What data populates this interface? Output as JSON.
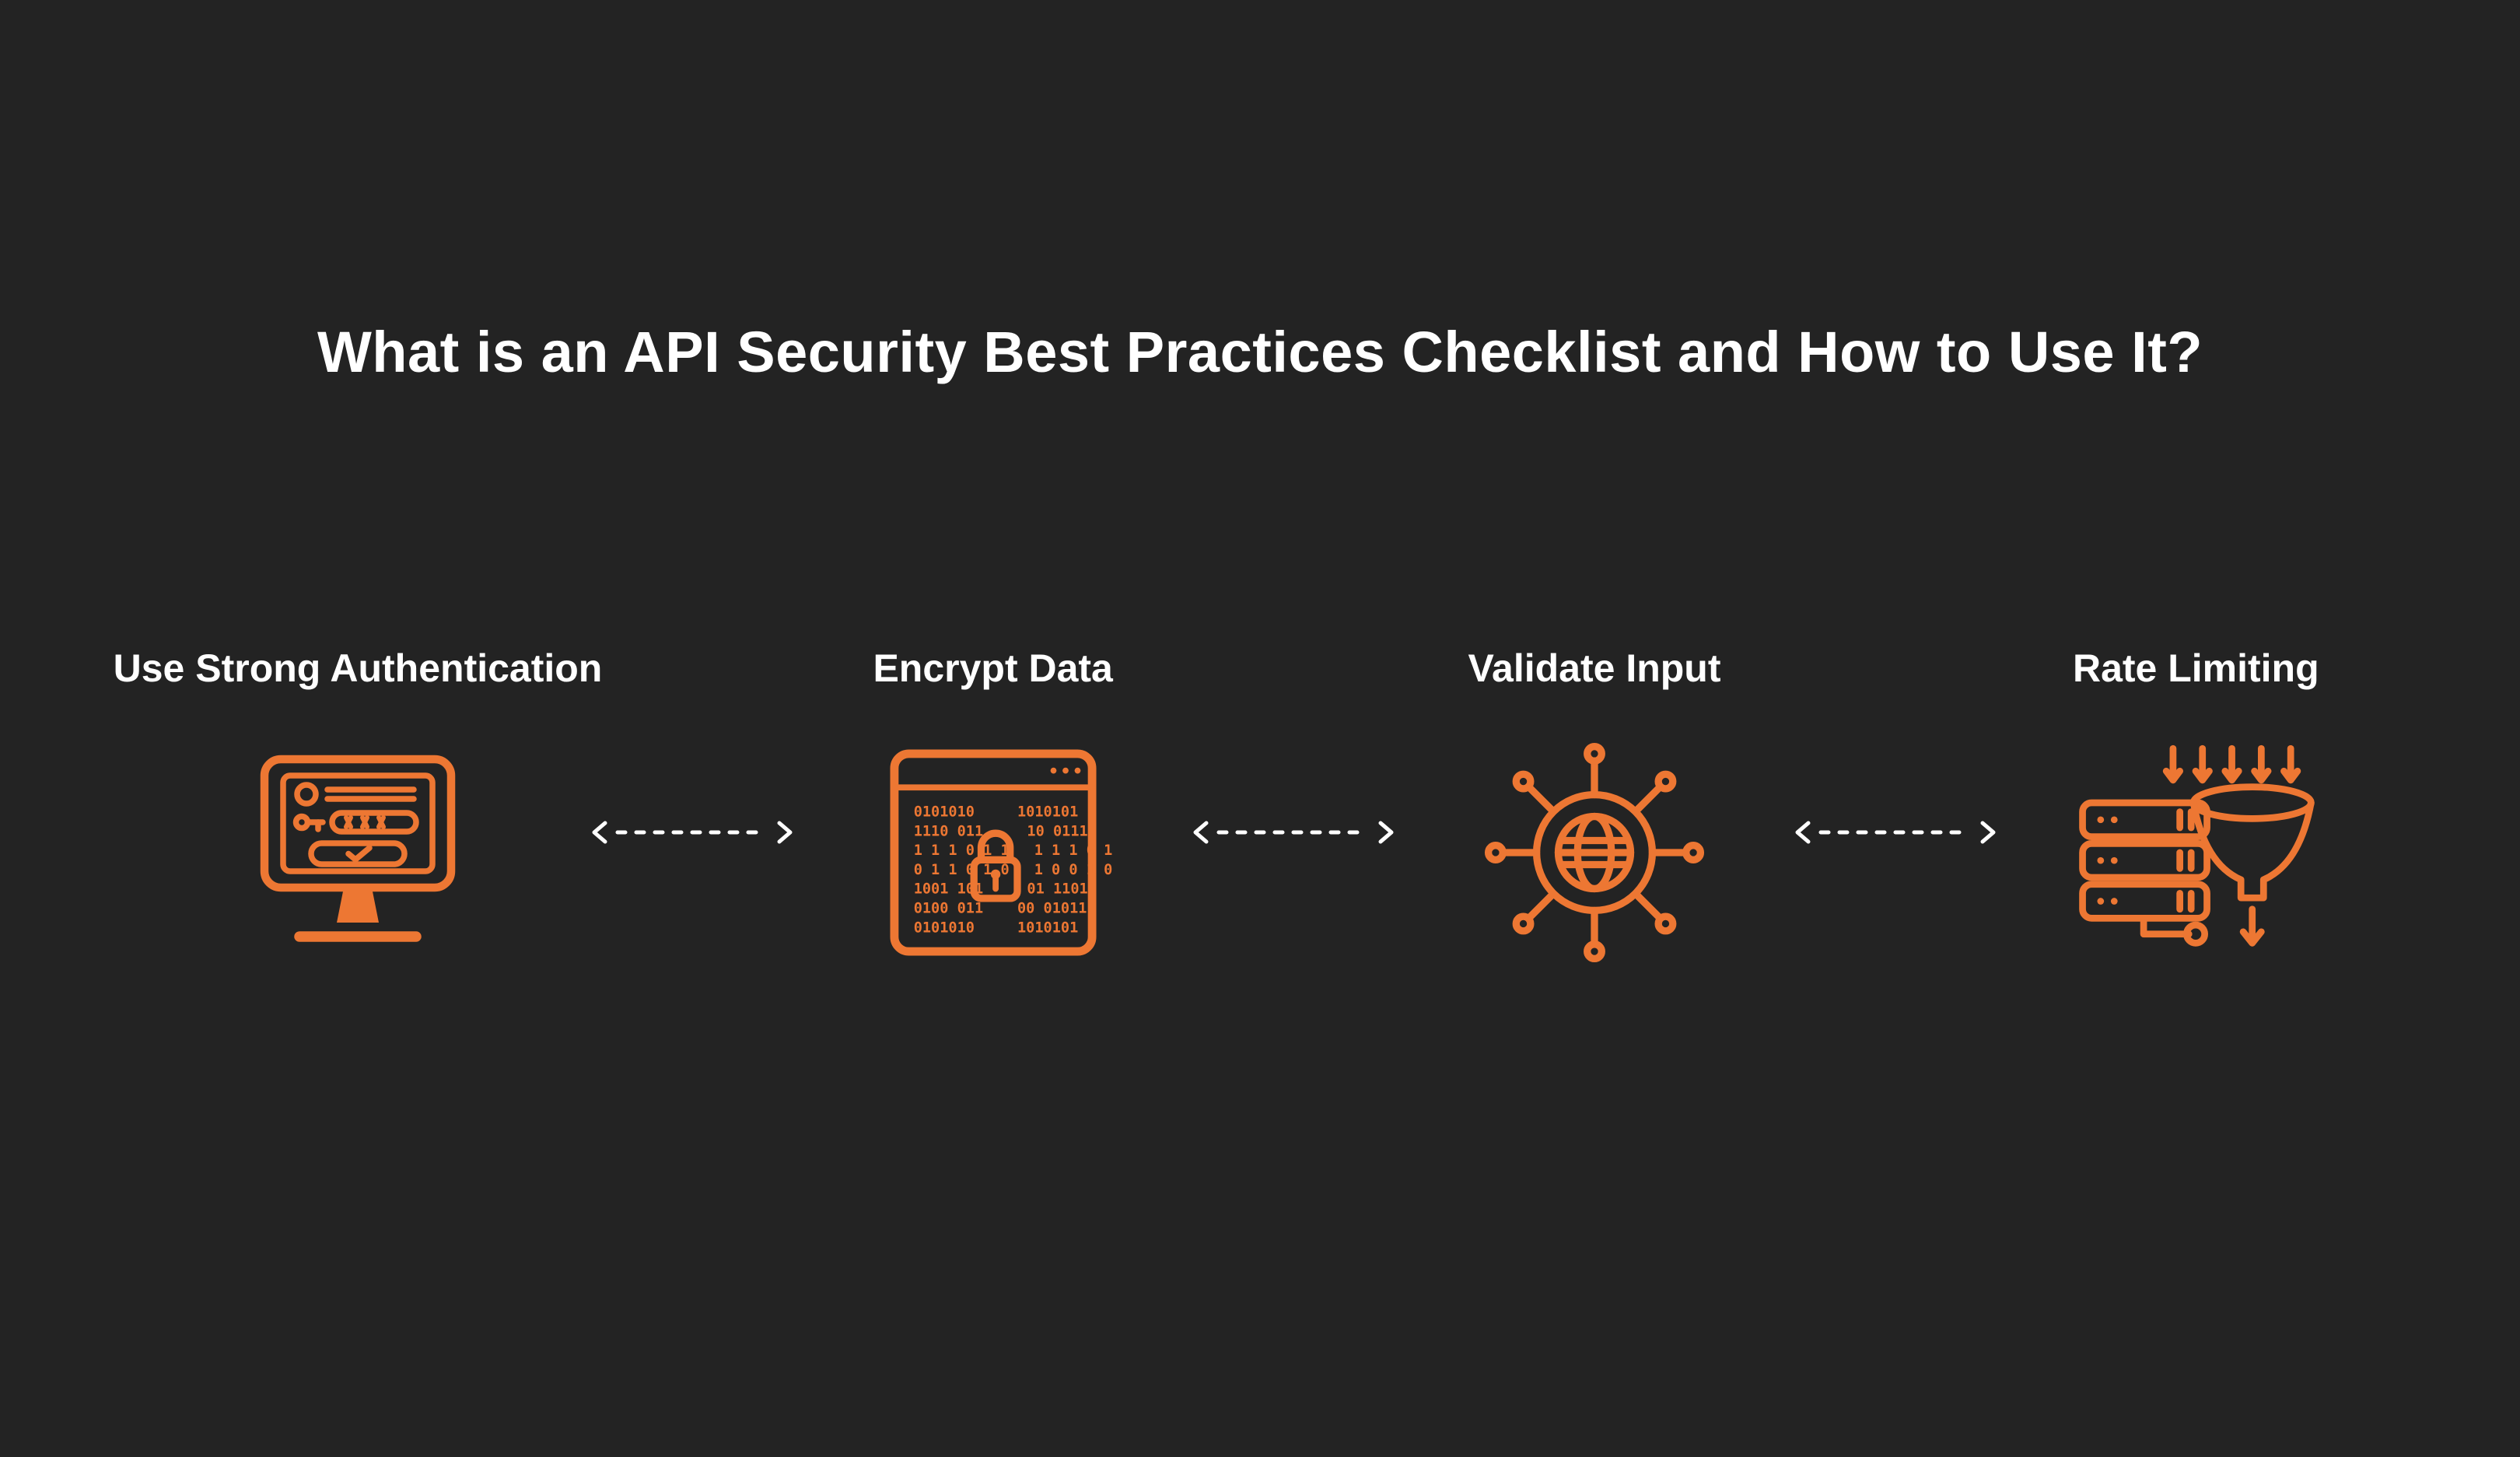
{
  "title": "What is an API Security Best Practices Checklist and How to Use It?",
  "accent": "#ED7733",
  "items": [
    {
      "label": "Use Strong Authentication",
      "icon": "authentication-monitor-icon"
    },
    {
      "label": "Encrypt Data",
      "icon": "encrypt-data-icon"
    },
    {
      "label": "Validate Input",
      "icon": "validate-input-gear-icon"
    },
    {
      "label": "Rate Limiting",
      "icon": "rate-limiting-funnel-icon"
    }
  ]
}
